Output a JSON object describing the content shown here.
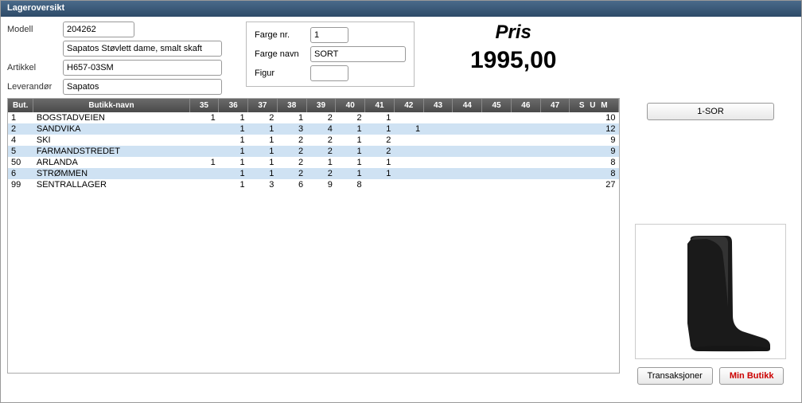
{
  "title": "Lageroversikt",
  "form": {
    "modell_label": "Modell",
    "modell_value": "204262",
    "desc_value": "Sapatos Støvlett dame, smalt skaft",
    "artikkel_label": "Artikkel",
    "artikkel_value": "H657-03SM",
    "leverandor_label": "Leverandør",
    "leverandor_value": "Sapatos",
    "fargenr_label": "Farge nr.",
    "fargenr_value": "1",
    "fargenavn_label": "Farge navn",
    "fargenavn_value": "SORT",
    "figur_label": "Figur",
    "figur_value": ""
  },
  "price": {
    "label": "Pris",
    "value": "1995,00"
  },
  "table": {
    "headers": {
      "but": "But.",
      "name": "Butikk-navn",
      "sizes": [
        "35",
        "36",
        "37",
        "38",
        "39",
        "40",
        "41",
        "42",
        "43",
        "44",
        "45",
        "46",
        "47"
      ],
      "sum": "S U M"
    },
    "rows": [
      {
        "but": "1",
        "name": "BOGSTADVEIEN",
        "cells": [
          "1",
          "1",
          "2",
          "1",
          "2",
          "2",
          "1",
          "",
          "",
          "",
          "",
          "",
          ""
        ],
        "sum": "10"
      },
      {
        "but": "2",
        "name": "SANDVIKA",
        "cells": [
          "",
          "1",
          "1",
          "3",
          "4",
          "1",
          "1",
          "1",
          "",
          "",
          "",
          "",
          ""
        ],
        "sum": "12"
      },
      {
        "but": "4",
        "name": "SKI",
        "cells": [
          "",
          "1",
          "1",
          "2",
          "2",
          "1",
          "2",
          "",
          "",
          "",
          "",
          "",
          ""
        ],
        "sum": "9"
      },
      {
        "but": "5",
        "name": "FARMANDSTREDET",
        "cells": [
          "",
          "1",
          "1",
          "2",
          "2",
          "1",
          "2",
          "",
          "",
          "",
          "",
          "",
          ""
        ],
        "sum": "9"
      },
      {
        "but": "50",
        "name": "ARLANDA",
        "cells": [
          "1",
          "1",
          "1",
          "2",
          "1",
          "1",
          "1",
          "",
          "",
          "",
          "",
          "",
          ""
        ],
        "sum": "8"
      },
      {
        "but": "6",
        "name": "STRØMMEN",
        "cells": [
          "",
          "1",
          "1",
          "2",
          "2",
          "1",
          "1",
          "",
          "",
          "",
          "",
          "",
          ""
        ],
        "sum": "8"
      },
      {
        "but": "99",
        "name": "SENTRALLAGER",
        "cells": [
          "",
          "1",
          "3",
          "6",
          "9",
          "8",
          "",
          "",
          "",
          "",
          "",
          "",
          ""
        ],
        "sum": "27"
      }
    ]
  },
  "buttons": {
    "sor": "1-SOR",
    "transaksjoner": "Transaksjoner",
    "min_butikk": "Min Butikk"
  }
}
